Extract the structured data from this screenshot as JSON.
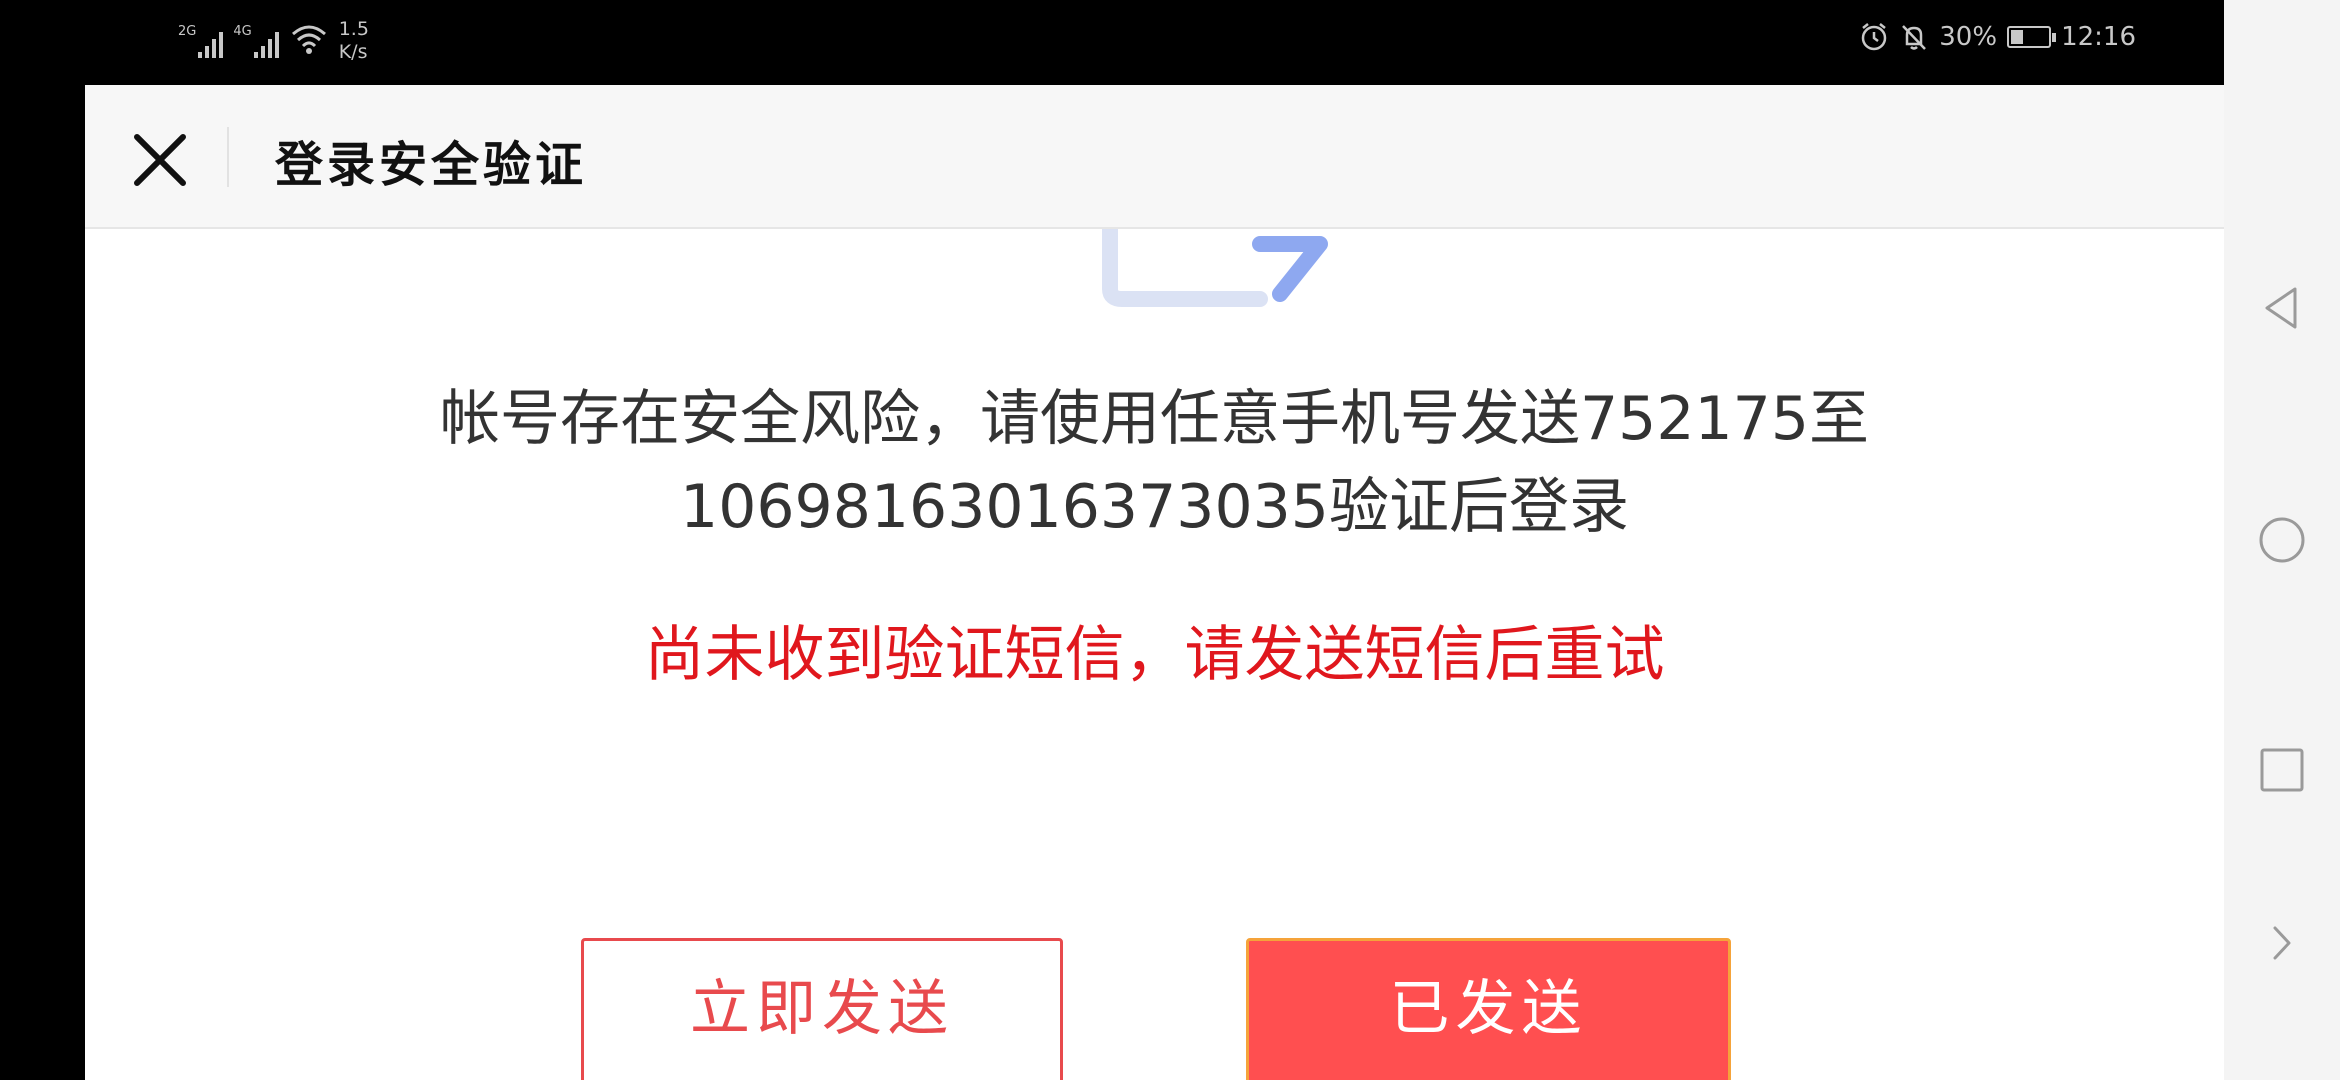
{
  "status_bar": {
    "sim1_tag": "2G",
    "sim2_tag": "4G",
    "net_speed_value": "1.5",
    "net_speed_unit": "K/s",
    "battery_percent": "30%",
    "time": "12:16",
    "icons": [
      "signal-icon",
      "wifi-icon",
      "alarm-icon",
      "mute-icon",
      "battery-charging-icon"
    ]
  },
  "header": {
    "title": "登录安全验证",
    "close_icon": "close-icon"
  },
  "main": {
    "message_line1": "帐号存在安全风险，请使用任意手机号发送752175至",
    "message_line2": "10698163016373035验证后登录",
    "warning": "尚未收到验证短信，请发送短信后重试",
    "send_now_label": "立即发送",
    "sent_label": "已发送",
    "colors": {
      "warning": "#e0171d",
      "primary": "#ff4f50",
      "outline": "#e84a4d",
      "illustration": "#8ea8f0"
    }
  },
  "nav_bar": {
    "icons": [
      "back-triangle-icon",
      "home-circle-icon",
      "recents-square-icon",
      "expand-chevron-icon"
    ]
  }
}
